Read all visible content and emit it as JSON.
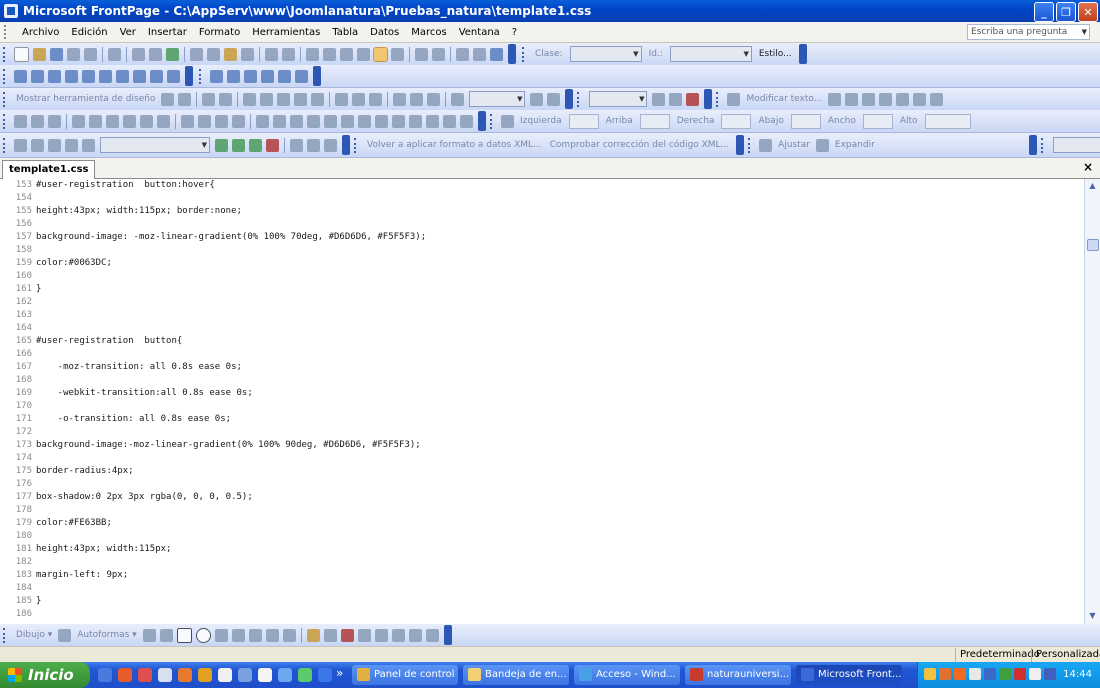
{
  "window": {
    "title": "Microsoft FrontPage - C:\\AppServ\\www\\Joomlanatura\\Pruebas_natura\\template1.css",
    "controls": [
      "minimize-icon",
      "maximize-icon",
      "close-icon"
    ]
  },
  "menu": {
    "items": [
      "Archivo",
      "Edición",
      "Ver",
      "Insertar",
      "Formato",
      "Herramientas",
      "Tabla",
      "Datos",
      "Marcos",
      "Ventana",
      "?"
    ],
    "ask_placeholder": "Escriba una pregunta"
  },
  "toolbars": {
    "standard": {
      "clase_label": "Clase:",
      "id_label": "Id.:",
      "estilo_label": "Estilo..."
    },
    "design": {
      "mostrar_label": "Mostrar herramienta de diseño",
      "modificar_label": "Modificar texto..."
    },
    "positioning": [
      "Izquierda",
      "Arriba",
      "Derecha",
      "Abajo",
      "Ancho",
      "Alto"
    ],
    "xml": {
      "reaplicar_label": "Volver a aplicar formato a datos XML...",
      "comprobar_label": "Comprobar corrección del código XML...",
      "ajustar_label": "Ajustar",
      "expandir_label": "Expandir"
    }
  },
  "document": {
    "tab_label": "template1.css",
    "close_glyph": "×",
    "lines": [
      {
        "n": "153",
        "text": "#user-registration  button:hover{"
      },
      {
        "n": "154",
        "text": ""
      },
      {
        "n": "155",
        "text": "height:43px; width:115px; border:none;"
      },
      {
        "n": "156",
        "text": ""
      },
      {
        "n": "157",
        "text": "background-image: -moz-linear-gradient(0% 100% 70deg, #D6D6D6, #F5F5F3);"
      },
      {
        "n": "158",
        "text": ""
      },
      {
        "n": "159",
        "text": "color:#0063DC;"
      },
      {
        "n": "160",
        "text": ""
      },
      {
        "n": "161",
        "text": "}"
      },
      {
        "n": "162",
        "text": ""
      },
      {
        "n": "163",
        "text": ""
      },
      {
        "n": "164",
        "text": ""
      },
      {
        "n": "165",
        "text": "#user-registration  button{"
      },
      {
        "n": "166",
        "text": ""
      },
      {
        "n": "167",
        "text": "    -moz-transition: all 0.8s ease 0s;"
      },
      {
        "n": "168",
        "text": ""
      },
      {
        "n": "169",
        "text": "    -webkit-transition:all 0.8s ease 0s;"
      },
      {
        "n": "170",
        "text": ""
      },
      {
        "n": "171",
        "text": "    -o-transition: all 0.8s ease 0s;"
      },
      {
        "n": "172",
        "text": ""
      },
      {
        "n": "173",
        "text": "background-image:-moz-linear-gradient(0% 100% 90deg, #D6D6D6, #F5F5F3);"
      },
      {
        "n": "174",
        "text": ""
      },
      {
        "n": "175",
        "text": "border-radius:4px;"
      },
      {
        "n": "176",
        "text": ""
      },
      {
        "n": "177",
        "text": "box-shadow:0 2px 3px rgba(0, 0, 0, 0.5);"
      },
      {
        "n": "178",
        "text": ""
      },
      {
        "n": "179",
        "text": "color:#FE63BB;"
      },
      {
        "n": "180",
        "text": ""
      },
      {
        "n": "181",
        "text": "height:43px; width:115px;"
      },
      {
        "n": "182",
        "text": ""
      },
      {
        "n": "183",
        "text": "margin-left: 9px;"
      },
      {
        "n": "184",
        "text": ""
      },
      {
        "n": "185",
        "text": "}"
      },
      {
        "n": "186",
        "text": ""
      }
    ]
  },
  "drawing_toolbar": {
    "dibujo_label": "Dibujo ▾",
    "autoformas_label": "Autoformas ▾"
  },
  "statusbar": {
    "mode": "Predeterminado",
    "custom": "Personalizada"
  },
  "taskbar": {
    "start_label": "Inicio",
    "chevron": "»",
    "tasks": [
      {
        "label": "Panel de control",
        "active": false
      },
      {
        "label": "Bandeja de en...",
        "active": false
      },
      {
        "label": "Acceso - Wind...",
        "active": false
      },
      {
        "label": "naturauniversi...",
        "active": false
      },
      {
        "label": "Microsoft Front...",
        "active": true
      }
    ],
    "clock": "14:44"
  }
}
